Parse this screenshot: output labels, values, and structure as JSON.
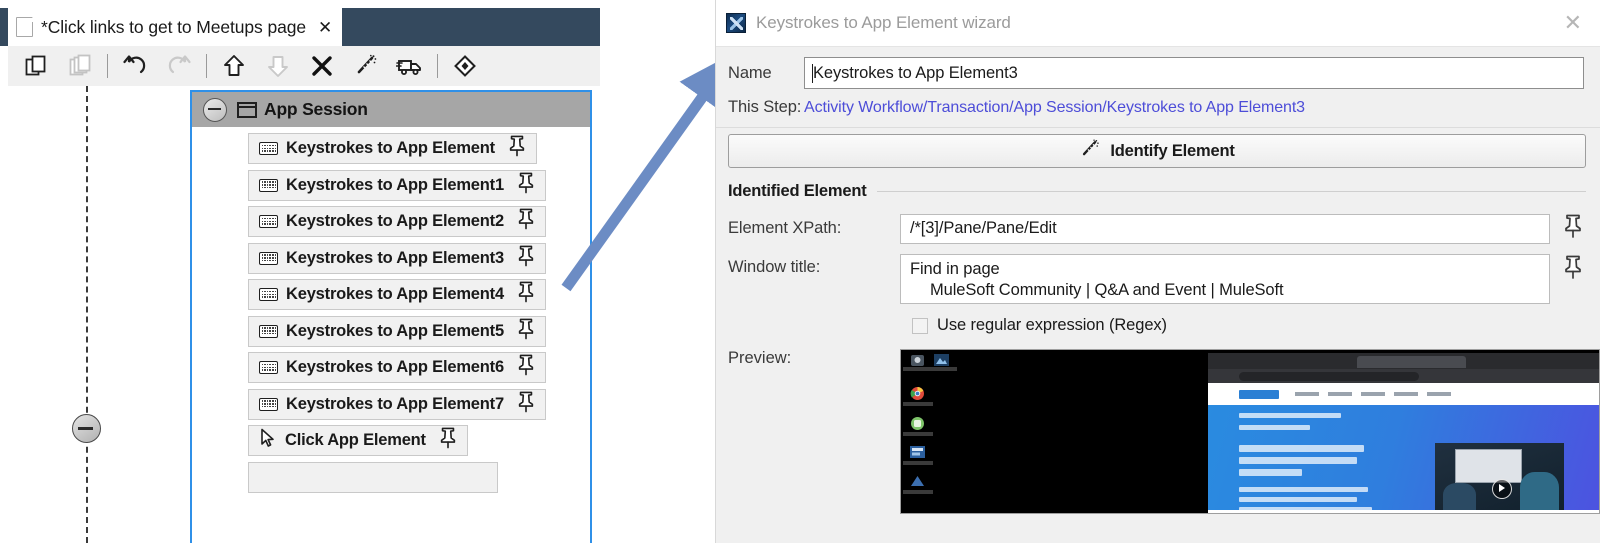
{
  "editor": {
    "tab": {
      "title": "*Click links to get to Meetups page",
      "close_label": "✕",
      "doc_icon": "document-icon"
    },
    "toolbar": {
      "buttons": [
        {
          "name": "copy",
          "icon": "copy-icon",
          "enabled": true
        },
        {
          "name": "paste",
          "icon": "paste-icon",
          "enabled": false
        },
        {
          "name": "undo",
          "icon": "undo-icon",
          "enabled": true
        },
        {
          "name": "redo",
          "icon": "redo-icon",
          "enabled": false
        },
        {
          "name": "move-up",
          "icon": "arrow-up-icon",
          "enabled": true
        },
        {
          "name": "move-down",
          "icon": "arrow-down-icon",
          "enabled": false
        },
        {
          "name": "delete",
          "icon": "close-x-icon",
          "enabled": true
        },
        {
          "name": "identify",
          "icon": "magic-wand-icon",
          "enabled": true
        },
        {
          "name": "deploy",
          "icon": "truck-icon",
          "enabled": true
        },
        {
          "name": "properties",
          "icon": "diamond-icon",
          "enabled": true
        }
      ]
    },
    "tree": {
      "header": {
        "label": "App Session",
        "collapse_icon": "collapse-minus-icon",
        "type_icon": "window-icon"
      },
      "nodes": [
        {
          "label": "Keystrokes to App Element",
          "icon": "keyboard-icon",
          "pin": "pin-icon",
          "selected": false
        },
        {
          "label": "Keystrokes to App Element1",
          "icon": "keyboard-icon",
          "pin": "pin-icon",
          "selected": false
        },
        {
          "label": "Keystrokes to App Element2",
          "icon": "keyboard-icon",
          "pin": "pin-icon",
          "selected": false
        },
        {
          "label": "Keystrokes to App Element3",
          "icon": "keyboard-icon",
          "pin": "pin-icon",
          "selected": true
        },
        {
          "label": "Keystrokes to App Element4",
          "icon": "keyboard-icon",
          "pin": "pin-icon",
          "selected": false
        },
        {
          "label": "Keystrokes to App Element5",
          "icon": "keyboard-icon",
          "pin": "pin-icon",
          "selected": false
        },
        {
          "label": "Keystrokes to App Element6",
          "icon": "keyboard-icon",
          "pin": "pin-icon",
          "selected": false
        },
        {
          "label": "Keystrokes to App Element7",
          "icon": "keyboard-icon",
          "pin": "pin-icon",
          "selected": false
        },
        {
          "label": "Click App Element",
          "icon": "mouse-cursor-icon",
          "pin": "pin-icon",
          "selected": false
        }
      ]
    },
    "collapse_bubble_icon": "collapse-minus-icon"
  },
  "annotation": {
    "arrow_color": "#6c8cc4",
    "arrow_from": "tree node Keystrokes to App Element3",
    "arrow_to": "Name field"
  },
  "wizard": {
    "title": "Keystrokes to App Element wizard",
    "app_icon": "wizard-app-icon",
    "close_label": "✕",
    "name": {
      "label": "Name",
      "value": "Keystrokes to App Element3",
      "placeholder": ""
    },
    "this_step": {
      "label": "This Step:",
      "path": "Activity Workflow/Transaction/App Session/Keystrokes to App Element3",
      "link_color": "#4d4dd8"
    },
    "identify_button": {
      "label": "Identify Element",
      "icon": "magic-wand-icon"
    },
    "identified_element": {
      "legend": "Identified Element",
      "xpath": {
        "label": "Element XPath:",
        "value": "/*[3]/Pane/Pane/Edit",
        "pin_icon": "pin-icon"
      },
      "window_title": {
        "label": "Window title:",
        "line1": "Find in page",
        "line2": "MuleSoft Community | Q&A and Event | MuleSoft",
        "pin_icon": "pin-icon"
      },
      "regex": {
        "label": "Use regular expression (Regex)",
        "checked": false
      },
      "preview": {
        "label": "Preview:",
        "description": "desktop screenshot with browser window showing MuleSoft Community page"
      }
    }
  }
}
